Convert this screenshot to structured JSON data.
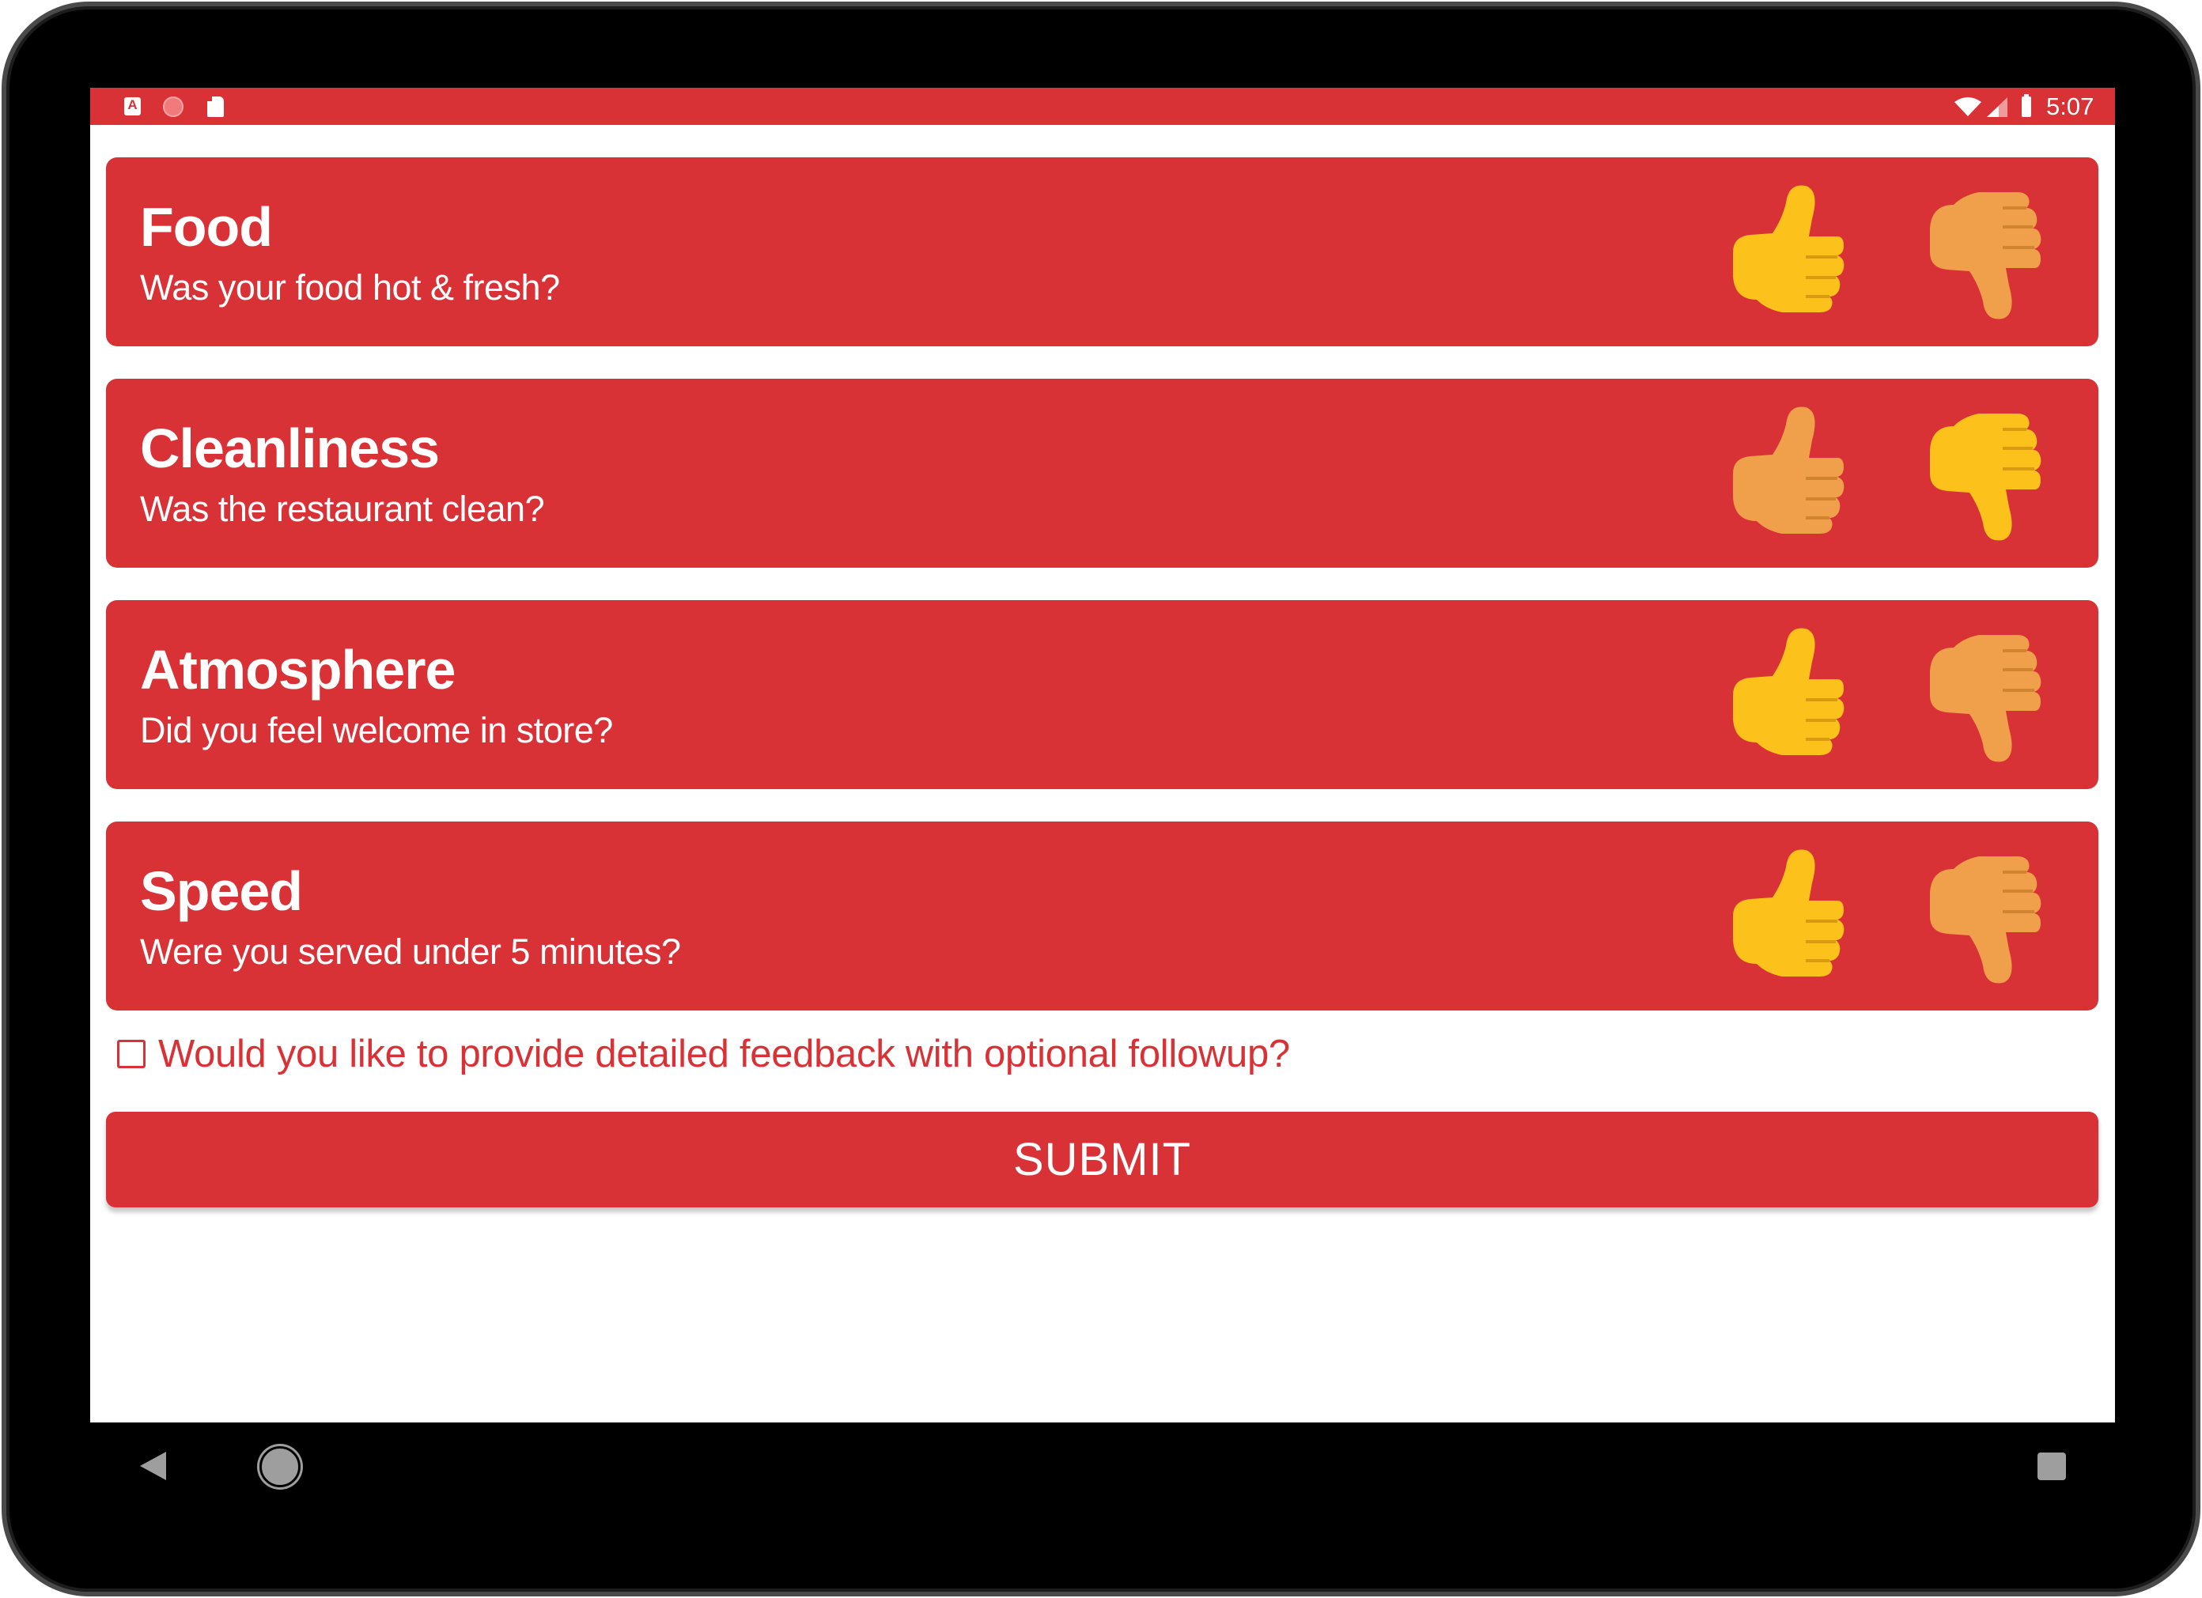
{
  "status_bar": {
    "left_icons": [
      "keyboard-a-icon",
      "screen-record-icon",
      "sd-card-icon"
    ],
    "keyboard_icon_glyph": "A",
    "right_icons": [
      "wifi-icon",
      "signal-icon",
      "battery-icon"
    ],
    "time": "5:07"
  },
  "colors": {
    "accent": "#d93236",
    "thumb_selected": "#fcc21b",
    "thumb_unselected": "#f0a04a",
    "nav_icon": "#9e9e9e"
  },
  "questions": [
    {
      "title": "Food",
      "subtitle": "Was your food hot & fresh?",
      "selected": "up"
    },
    {
      "title": "Cleanliness",
      "subtitle": "Was the restaurant clean?",
      "selected": "down"
    },
    {
      "title": "Atmosphere",
      "subtitle": "Did you feel welcome in store?",
      "selected": "up"
    },
    {
      "title": "Speed",
      "subtitle": "Were you served under 5 minutes?",
      "selected": "up"
    }
  ],
  "feedback": {
    "label": "Would you like to provide detailed feedback with optional followup?",
    "checked": false
  },
  "submit": {
    "label": "SUBMIT"
  },
  "nav": {
    "icons": [
      "back-icon",
      "home-icon",
      "recent-apps-icon"
    ]
  }
}
